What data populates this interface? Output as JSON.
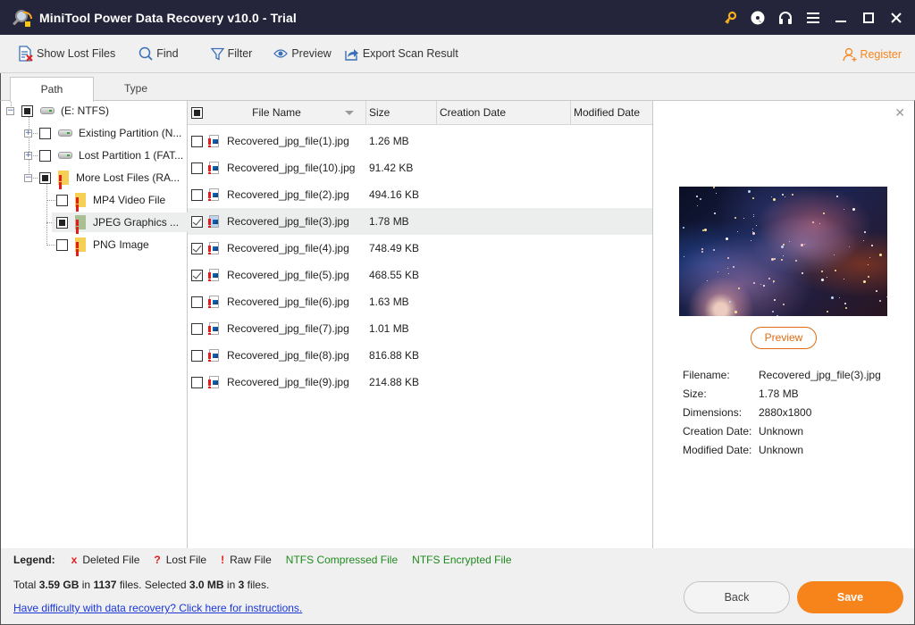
{
  "window": {
    "title": "MiniTool Power Data Recovery v10.0 - Trial",
    "controls": [
      "key-icon",
      "disc-icon",
      "headset-icon",
      "menu-icon",
      "minimize-icon",
      "maximize-icon",
      "close-icon"
    ]
  },
  "toolbar": {
    "show_lost_files": "Show Lost Files",
    "find": "Find",
    "filter": "Filter",
    "preview": "Preview",
    "export": "Export Scan Result",
    "register": "Register"
  },
  "tabs": [
    {
      "label": "Path",
      "active": true
    },
    {
      "label": "Type",
      "active": false
    }
  ],
  "tree": [
    {
      "label": "(E: NTFS)",
      "icon": "drive-icon",
      "check": "partial",
      "expander": "minus"
    },
    {
      "label": "Existing Partition (N...",
      "icon": "drive-icon",
      "check": "none",
      "expander": "plus"
    },
    {
      "label": "Lost Partition 1 (FAT...",
      "icon": "drive-icon",
      "check": "none",
      "expander": "plus"
    },
    {
      "label": "More Lost Files (RA...",
      "icon": "folder-icon",
      "check": "partial",
      "expander": "minus"
    },
    {
      "label": "MP4 Video File",
      "icon": "folder-icon",
      "check": "none"
    },
    {
      "label": "JPEG Graphics ...",
      "icon": "folder-icon",
      "check": "partial",
      "selected": true
    },
    {
      "label": "PNG Image",
      "icon": "folder-icon",
      "check": "none"
    }
  ],
  "file_list": {
    "columns": [
      "File Name",
      "Size",
      "Creation Date",
      "Modified Date"
    ],
    "rows": [
      {
        "name": "Recovered_jpg_file(1).jpg",
        "size": "1.26 MB",
        "checked": false
      },
      {
        "name": "Recovered_jpg_file(10).jpg",
        "size": "91.42 KB",
        "checked": false
      },
      {
        "name": "Recovered_jpg_file(2).jpg",
        "size": "494.16 KB",
        "checked": false
      },
      {
        "name": "Recovered_jpg_file(3).jpg",
        "size": "1.78 MB",
        "checked": true,
        "selected": true
      },
      {
        "name": "Recovered_jpg_file(4).jpg",
        "size": "748.49 KB",
        "checked": true
      },
      {
        "name": "Recovered_jpg_file(5).jpg",
        "size": "468.55 KB",
        "checked": true
      },
      {
        "name": "Recovered_jpg_file(6).jpg",
        "size": "1.63 MB",
        "checked": false
      },
      {
        "name": "Recovered_jpg_file(7).jpg",
        "size": "1.01 MB",
        "checked": false
      },
      {
        "name": "Recovered_jpg_file(8).jpg",
        "size": "816.88 KB",
        "checked": false
      },
      {
        "name": "Recovered_jpg_file(9).jpg",
        "size": "214.88 KB",
        "checked": false
      }
    ]
  },
  "preview": {
    "button": "Preview",
    "info": [
      {
        "label": "Filename:",
        "value": "Recovered_jpg_file(3).jpg"
      },
      {
        "label": "Size:",
        "value": "1.78 MB"
      },
      {
        "label": "Dimensions:",
        "value": "2880x1800"
      },
      {
        "label": "Creation Date:",
        "value": "Unknown"
      },
      {
        "label": "Modified Date:",
        "value": "Unknown"
      }
    ]
  },
  "legend": {
    "label": "Legend:",
    "items": [
      {
        "symbol": "x",
        "text": "Deleted File"
      },
      {
        "symbol": "?",
        "text": "Lost File"
      },
      {
        "symbol": "!",
        "text": "Raw File"
      },
      {
        "symbol": "",
        "text": "NTFS Compressed File"
      },
      {
        "symbol": "",
        "text": "NTFS Encrypted File"
      }
    ],
    "colors": {
      "symbol": "#e31b1b",
      "ntfs": "#1f8a1f"
    }
  },
  "status": {
    "total_prefix": "Total",
    "total_size": "3.59 GB",
    "in1": "in",
    "total_files": "1137",
    "files1": "files.  Selected",
    "selected_size": "3.0 MB",
    "in2": "in",
    "selected_files": "3",
    "files2": "files."
  },
  "help_link": "Have difficulty with data recovery? Click here for instructions.",
  "buttons": {
    "back": "Back",
    "save": "Save"
  },
  "colors": {
    "accent": "#f7831b",
    "titlebar": "#24253a",
    "link": "#1a37d8"
  }
}
